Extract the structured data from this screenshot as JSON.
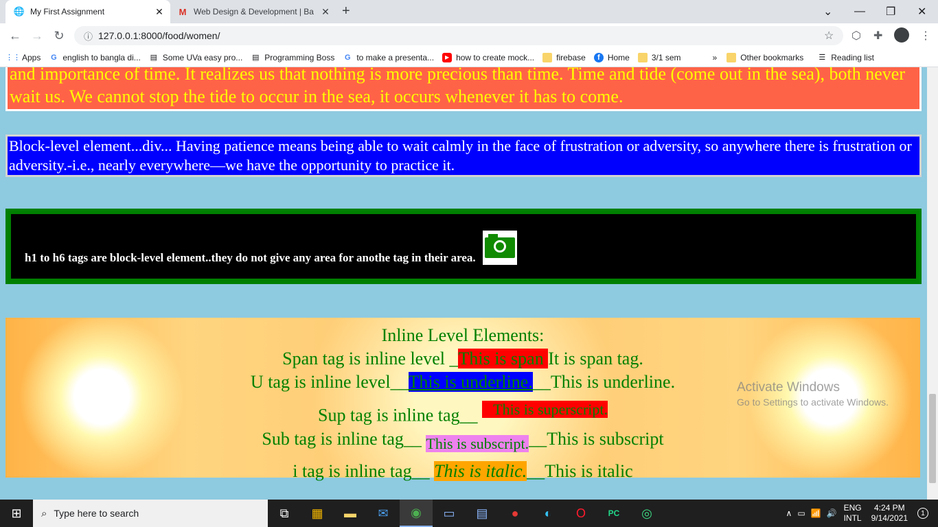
{
  "browser": {
    "tabs": [
      {
        "title": "My First Assignment",
        "favicon": "globe-icon"
      },
      {
        "title": "Web Design & Development | Ba",
        "favicon": "gmail-icon"
      }
    ],
    "url": "127.0.0.1:8000/food/women/",
    "bookmarks": [
      {
        "label": "Apps",
        "icon": "apps-grid-icon"
      },
      {
        "label": "english to bangla di...",
        "icon": "google-icon"
      },
      {
        "label": "Some UVa easy pro...",
        "icon": "page-icon"
      },
      {
        "label": "Programming Boss",
        "icon": "page-icon"
      },
      {
        "label": "to make a presenta...",
        "icon": "google-icon"
      },
      {
        "label": "how to create mock...",
        "icon": "youtube-icon"
      },
      {
        "label": "firebase",
        "icon": "folder-icon"
      },
      {
        "label": "Home",
        "icon": "facebook-icon"
      },
      {
        "label": "3/1 sem",
        "icon": "folder-icon"
      }
    ],
    "bookmarks_overflow": "»",
    "other_bookmarks": "Other bookmarks",
    "reading_list": "Reading list"
  },
  "page": {
    "box1_text": "and importance of time. It realizes us that nothing is more precious than time. Time and tide (come out in the sea), both never wait us. We cannot stop the tide to occur in the sea, it occurs whenever it has to come.",
    "box2_text": "Block-level element...div... Having patience means being able to wait calmly in the face of frustration or adversity, so anywhere there is frustration or adversity.-i.e., nearly everywhere—we have the opportunity to practice it.",
    "box3_heading": "h1 to h6 tags are block-level element..they do not give any area for anothe tag in their area.",
    "inline": {
      "title": "Inline Level Elements:",
      "span_prefix": "Span tag is inline level _",
      "span_text": "This is span ",
      "span_suffix": "It is span tag.",
      "u_prefix": "U tag is inline level__",
      "u_text": "This is underline.",
      "u_suffix": "__This is underline.",
      "sup_prefix": "Sup tag is inline tag__ ",
      "sup_text": "   This is superscript.",
      "sub_prefix": "Sub tag is inline tag__ ",
      "sub_text": "This is subscript.",
      "sub_suffix": "__This is subscript",
      "i_prefix": "i tag is inline tag__ ",
      "i_text": "This is italic.",
      "i_suffix": "__This is italic"
    },
    "watermark": {
      "line1": "Activate Windows",
      "line2": "Go to Settings to activate Windows."
    }
  },
  "taskbar": {
    "search_placeholder": "Type here to search",
    "lang_line1": "ENG",
    "lang_line2": "INTL",
    "time": "4:24 PM",
    "date": "9/14/2021",
    "notification_count": "1"
  }
}
